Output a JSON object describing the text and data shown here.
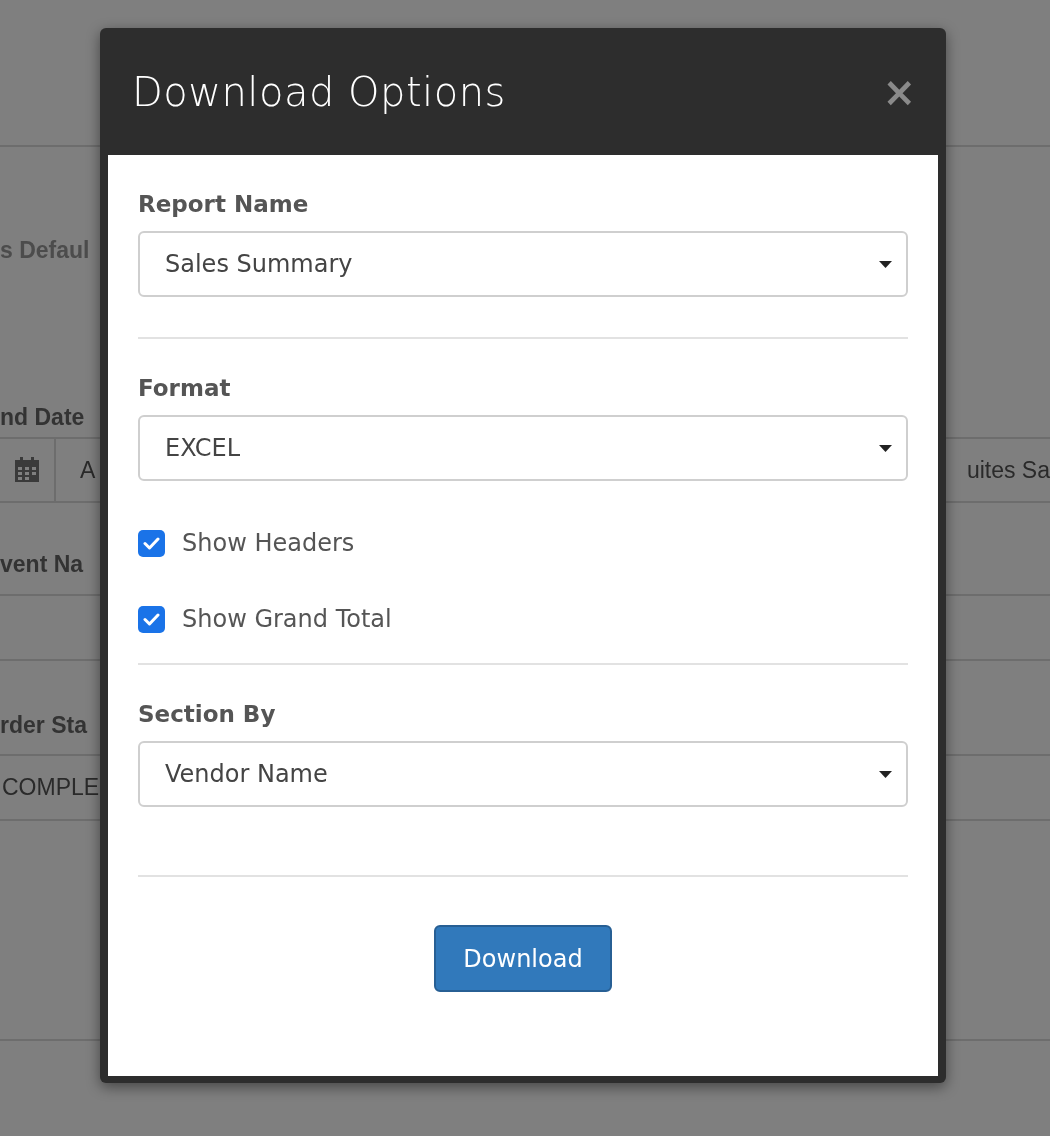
{
  "background": {
    "heading": "s Defaul",
    "end_date_label": "nd Date",
    "end_date_value": "A",
    "right_field_value": "uites Sa",
    "event_name_label": "vent Na",
    "order_status_label": "rder Sta",
    "order_status_value": "COMPLE"
  },
  "dialog": {
    "title": "Download Options",
    "close": "×",
    "sections": [
      {
        "kind": "select",
        "label": "Report Name",
        "value": "Sales Summary"
      },
      {
        "kind": "select",
        "label": "Format",
        "value": "EXCEL",
        "options": [
          {
            "label": "Show Headers",
            "checked": true
          },
          {
            "label": "Show Grand Total",
            "checked": true
          }
        ]
      },
      {
        "kind": "select",
        "label": "Section By",
        "value": "Vendor Name"
      }
    ],
    "button": "Download"
  }
}
